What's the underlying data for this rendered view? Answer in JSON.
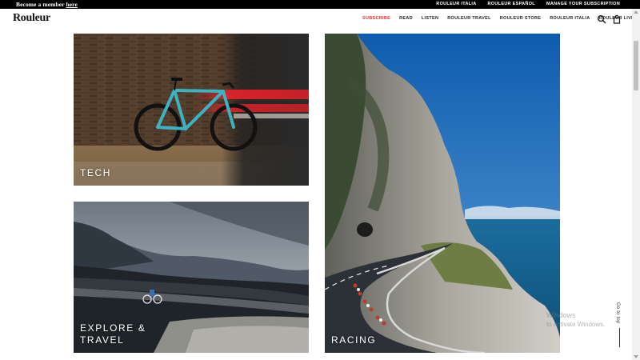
{
  "topbar": {
    "member_prefix": "Become a member ",
    "member_link": "here",
    "links": [
      "ROULEUR ITALIA",
      "ROULEUR ESPAÑOL",
      "MANAGE YOUR SUBSCRIPTION"
    ]
  },
  "header": {
    "logo": "Rouleur",
    "nav": [
      "SUBSCRIBE",
      "READ",
      "LISTEN",
      "ROULEUR TRAVEL",
      "ROULEUR STORE",
      "ROULEUR ITALIA",
      "ROULEUR LIVE"
    ],
    "accent_color": "#e2343c",
    "icons": [
      "search-icon",
      "bag-icon"
    ]
  },
  "cards": {
    "tech": "TECH",
    "explore_line1": "EXPLORE &",
    "explore_line2": "TRAVEL",
    "racing": "RACING"
  },
  "watermark": {
    "line1": "Windows",
    "line2": "to activate Windows."
  },
  "go_to_top": "Go to top"
}
